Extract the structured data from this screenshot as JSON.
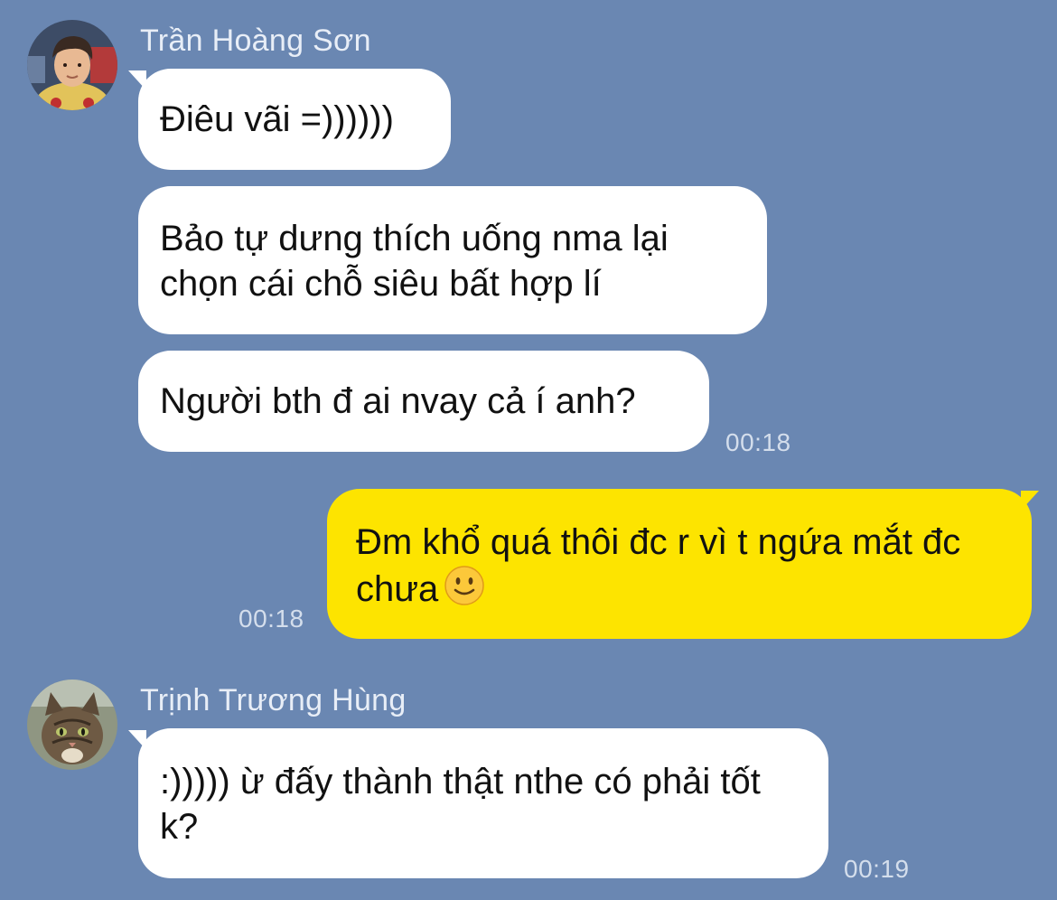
{
  "colors": {
    "background": "#6a87b2",
    "incoming_bubble": "#ffffff",
    "outgoing_bubble": "#fde400",
    "meta_text": "#d4deec"
  },
  "messages": [
    {
      "sender": "Trần Hoàng Sơn",
      "direction": "incoming",
      "avatar": "avatar-boy-photo",
      "bubbles": [
        {
          "text": "Điêu vãi =))))))"
        },
        {
          "text": "Bảo tự dưng thích uống nma lại chọn cái chỗ siêu bất hợp lí"
        },
        {
          "text": "Người bth đ ai nvay cả í anh?"
        }
      ],
      "time": "00:18"
    },
    {
      "sender": "",
      "direction": "outgoing",
      "bubbles": [
        {
          "text": "Đm khổ quá thôi đc r vì t ngứa mắt đc chưa",
          "emoji": "slightly-smiling-face-icon"
        }
      ],
      "time": "00:18"
    },
    {
      "sender": "Trịnh Trương Hùng",
      "direction": "incoming",
      "avatar": "avatar-cat-photo",
      "bubbles": [
        {
          "text": ":))))) ừ đấy thành thật nthe có phải tốt k?"
        }
      ],
      "time": "00:19"
    }
  ]
}
